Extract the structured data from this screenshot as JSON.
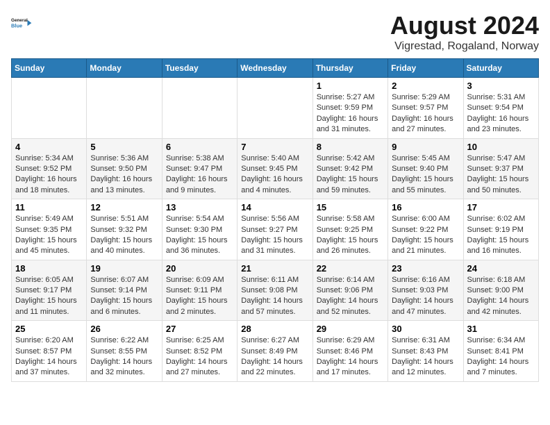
{
  "header": {
    "logo_line1": "General",
    "logo_line2": "Blue",
    "month_title": "August 2024",
    "subtitle": "Vigrestad, Rogaland, Norway"
  },
  "weekdays": [
    "Sunday",
    "Monday",
    "Tuesday",
    "Wednesday",
    "Thursday",
    "Friday",
    "Saturday"
  ],
  "weeks": [
    [
      {
        "day": "",
        "info": ""
      },
      {
        "day": "",
        "info": ""
      },
      {
        "day": "",
        "info": ""
      },
      {
        "day": "",
        "info": ""
      },
      {
        "day": "1",
        "info": "Sunrise: 5:27 AM\nSunset: 9:59 PM\nDaylight: 16 hours\nand 31 minutes."
      },
      {
        "day": "2",
        "info": "Sunrise: 5:29 AM\nSunset: 9:57 PM\nDaylight: 16 hours\nand 27 minutes."
      },
      {
        "day": "3",
        "info": "Sunrise: 5:31 AM\nSunset: 9:54 PM\nDaylight: 16 hours\nand 23 minutes."
      }
    ],
    [
      {
        "day": "4",
        "info": "Sunrise: 5:34 AM\nSunset: 9:52 PM\nDaylight: 16 hours\nand 18 minutes."
      },
      {
        "day": "5",
        "info": "Sunrise: 5:36 AM\nSunset: 9:50 PM\nDaylight: 16 hours\nand 13 minutes."
      },
      {
        "day": "6",
        "info": "Sunrise: 5:38 AM\nSunset: 9:47 PM\nDaylight: 16 hours\nand 9 minutes."
      },
      {
        "day": "7",
        "info": "Sunrise: 5:40 AM\nSunset: 9:45 PM\nDaylight: 16 hours\nand 4 minutes."
      },
      {
        "day": "8",
        "info": "Sunrise: 5:42 AM\nSunset: 9:42 PM\nDaylight: 15 hours\nand 59 minutes."
      },
      {
        "day": "9",
        "info": "Sunrise: 5:45 AM\nSunset: 9:40 PM\nDaylight: 15 hours\nand 55 minutes."
      },
      {
        "day": "10",
        "info": "Sunrise: 5:47 AM\nSunset: 9:37 PM\nDaylight: 15 hours\nand 50 minutes."
      }
    ],
    [
      {
        "day": "11",
        "info": "Sunrise: 5:49 AM\nSunset: 9:35 PM\nDaylight: 15 hours\nand 45 minutes."
      },
      {
        "day": "12",
        "info": "Sunrise: 5:51 AM\nSunset: 9:32 PM\nDaylight: 15 hours\nand 40 minutes."
      },
      {
        "day": "13",
        "info": "Sunrise: 5:54 AM\nSunset: 9:30 PM\nDaylight: 15 hours\nand 36 minutes."
      },
      {
        "day": "14",
        "info": "Sunrise: 5:56 AM\nSunset: 9:27 PM\nDaylight: 15 hours\nand 31 minutes."
      },
      {
        "day": "15",
        "info": "Sunrise: 5:58 AM\nSunset: 9:25 PM\nDaylight: 15 hours\nand 26 minutes."
      },
      {
        "day": "16",
        "info": "Sunrise: 6:00 AM\nSunset: 9:22 PM\nDaylight: 15 hours\nand 21 minutes."
      },
      {
        "day": "17",
        "info": "Sunrise: 6:02 AM\nSunset: 9:19 PM\nDaylight: 15 hours\nand 16 minutes."
      }
    ],
    [
      {
        "day": "18",
        "info": "Sunrise: 6:05 AM\nSunset: 9:17 PM\nDaylight: 15 hours\nand 11 minutes."
      },
      {
        "day": "19",
        "info": "Sunrise: 6:07 AM\nSunset: 9:14 PM\nDaylight: 15 hours\nand 6 minutes."
      },
      {
        "day": "20",
        "info": "Sunrise: 6:09 AM\nSunset: 9:11 PM\nDaylight: 15 hours\nand 2 minutes."
      },
      {
        "day": "21",
        "info": "Sunrise: 6:11 AM\nSunset: 9:08 PM\nDaylight: 14 hours\nand 57 minutes."
      },
      {
        "day": "22",
        "info": "Sunrise: 6:14 AM\nSunset: 9:06 PM\nDaylight: 14 hours\nand 52 minutes."
      },
      {
        "day": "23",
        "info": "Sunrise: 6:16 AM\nSunset: 9:03 PM\nDaylight: 14 hours\nand 47 minutes."
      },
      {
        "day": "24",
        "info": "Sunrise: 6:18 AM\nSunset: 9:00 PM\nDaylight: 14 hours\nand 42 minutes."
      }
    ],
    [
      {
        "day": "25",
        "info": "Sunrise: 6:20 AM\nSunset: 8:57 PM\nDaylight: 14 hours\nand 37 minutes."
      },
      {
        "day": "26",
        "info": "Sunrise: 6:22 AM\nSunset: 8:55 PM\nDaylight: 14 hours\nand 32 minutes."
      },
      {
        "day": "27",
        "info": "Sunrise: 6:25 AM\nSunset: 8:52 PM\nDaylight: 14 hours\nand 27 minutes."
      },
      {
        "day": "28",
        "info": "Sunrise: 6:27 AM\nSunset: 8:49 PM\nDaylight: 14 hours\nand 22 minutes."
      },
      {
        "day": "29",
        "info": "Sunrise: 6:29 AM\nSunset: 8:46 PM\nDaylight: 14 hours\nand 17 minutes."
      },
      {
        "day": "30",
        "info": "Sunrise: 6:31 AM\nSunset: 8:43 PM\nDaylight: 14 hours\nand 12 minutes."
      },
      {
        "day": "31",
        "info": "Sunrise: 6:34 AM\nSunset: 8:41 PM\nDaylight: 14 hours\nand 7 minutes."
      }
    ]
  ]
}
